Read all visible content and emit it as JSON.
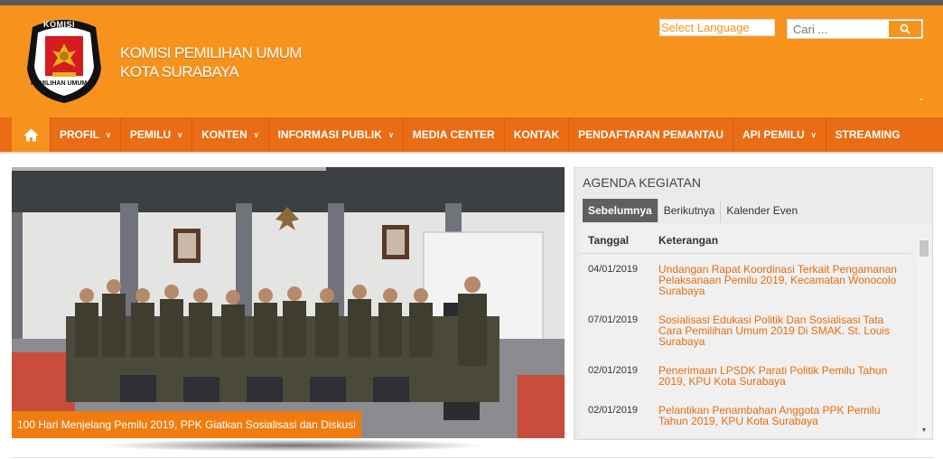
{
  "header": {
    "logo_top_text": "KOMISI",
    "logo_bottom_text": "PEMILIHAN UMUM",
    "title_line1": "KOMISI PEMILIHAN UMUM",
    "title_line2": "KOTA SURABAYA"
  },
  "language_select": {
    "label": "Select Language"
  },
  "search": {
    "placeholder": "Cari ...",
    "icon": "search-icon"
  },
  "colors": {
    "header": "#f7931d",
    "nav": "#ea6c14",
    "accent_link": "#e66c0f",
    "tab_active": "#5f5f5f"
  },
  "nav": {
    "home_icon": "home-icon",
    "items": [
      {
        "label": "PROFIL",
        "has_dropdown": true
      },
      {
        "label": "PEMILU",
        "has_dropdown": true
      },
      {
        "label": "KONTEN",
        "has_dropdown": true
      },
      {
        "label": "INFORMASI PUBLIK",
        "has_dropdown": true
      },
      {
        "label": "MEDIA CENTER",
        "has_dropdown": false
      },
      {
        "label": "KONTAK",
        "has_dropdown": false
      },
      {
        "label": "PENDAFTARAN PEMANTAU",
        "has_dropdown": false
      },
      {
        "label": "API PEMILU",
        "has_dropdown": true
      },
      {
        "label": "STREAMING",
        "has_dropdown": false
      }
    ]
  },
  "slider": {
    "caption": "100 Hari Menjelang Pemilu 2019, PPK Giatkan Sosialisasi dan Diskusi"
  },
  "agenda": {
    "title": "AGENDA KEGIATAN",
    "tabs": [
      "Sebelumnya",
      "Berikutnya",
      "Kalender Even"
    ],
    "active_tab": "Sebelumnya",
    "columns": [
      "Tanggal",
      "Keterangan"
    ],
    "rows": [
      {
        "date": "04/01/2019",
        "text": "Undangan Rapat Koordinasi Terkait Pengamanan Pelaksanaan Pemilu 2019, Kecamatan Wonocolo Surabaya"
      },
      {
        "date": "07/01/2019",
        "text": "Sosialisasi Edukasi Politik Dan Sosialisasi Tata Cara Pemilihan Umum 2019 Di SMAK. St. Louis Surabaya"
      },
      {
        "date": "02/01/2019",
        "text": "Penerimaan LPSDK Parati Politik Pemilu Tahun 2019, KPU Kota Surabaya"
      },
      {
        "date": "02/01/2019",
        "text": "Pelantikan Penambahan Anggota PPK Pemilu Tahun 2019, KPU Kota Surabaya"
      }
    ]
  }
}
